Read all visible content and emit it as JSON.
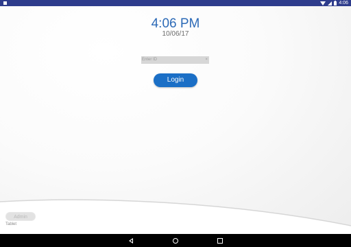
{
  "status_bar": {
    "time": "4:06"
  },
  "clock": {
    "time": "4:06 PM",
    "date": "10/06/17"
  },
  "login": {
    "id_placeholder": "Enter ID",
    "clear_symbol": "×",
    "button_label": "Login"
  },
  "footer": {
    "admin_label": "Admin",
    "device_label": "Tablet"
  },
  "colors": {
    "status_bar": "#2e3c8c",
    "accent": "#1b6fc6",
    "clock_text": "#2c6ab7"
  }
}
